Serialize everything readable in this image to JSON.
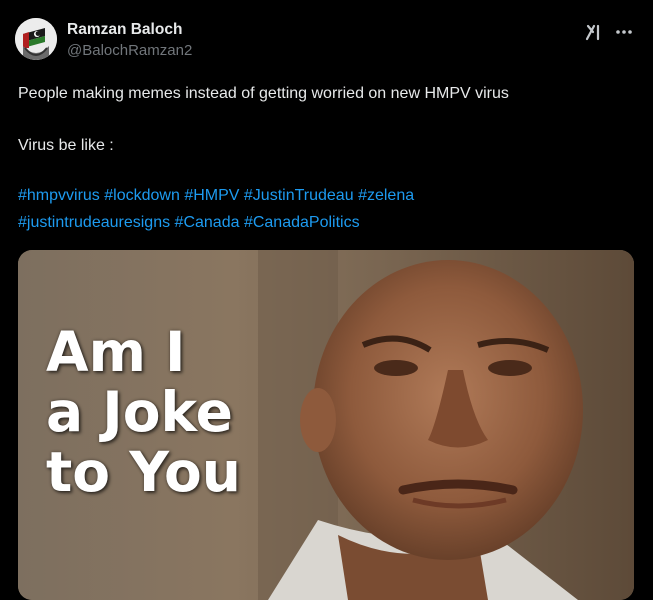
{
  "author": {
    "name": "Ramzan Baloch",
    "handle": "@BalochRamzan2"
  },
  "icons": {
    "grok": "grok-icon",
    "more": "more-icon"
  },
  "tweet": {
    "line1": "People making memes instead of getting worried on new HMPV virus",
    "line2": "Virus be like :",
    "hashtags_row1": [
      "#hmpvvirus",
      "#lockdown",
      "#HMPV",
      "#JustinTrudeau",
      "#zelena"
    ],
    "hashtags_row2": [
      "#justintrudeauresigns",
      "#Canada",
      "#CanadaPolitics"
    ]
  },
  "media": {
    "caption_lines": [
      "Am I",
      "a Joke",
      "to You"
    ]
  },
  "colors": {
    "background": "#000000",
    "text": "#e7e9ea",
    "secondary": "#71767b",
    "link": "#1d9bf0"
  }
}
